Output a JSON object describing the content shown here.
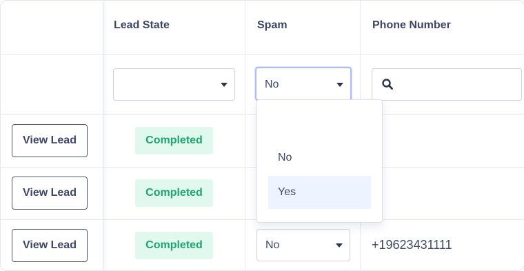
{
  "columns": {
    "lead_state": "Lead State",
    "spam": "Spam",
    "phone_number": "Phone Number"
  },
  "filters": {
    "lead_state_value": "",
    "spam_value": "No",
    "phone_search_value": ""
  },
  "spam_dropdown": {
    "options": [
      "",
      "No",
      "Yes"
    ],
    "highlighted": "Yes"
  },
  "rows": [
    {
      "action": "View Lead",
      "lead_state": "Completed",
      "spam": "",
      "phone": ""
    },
    {
      "action": "View Lead",
      "lead_state": "Completed",
      "spam": "",
      "phone": ""
    },
    {
      "action": "View Lead",
      "lead_state": "Completed",
      "spam": "No",
      "phone": "+19623431111"
    }
  ],
  "colors": {
    "badge_bg": "#e0f8ee",
    "badge_text": "#1fa56e",
    "focus_border": "#a9bdfb"
  }
}
